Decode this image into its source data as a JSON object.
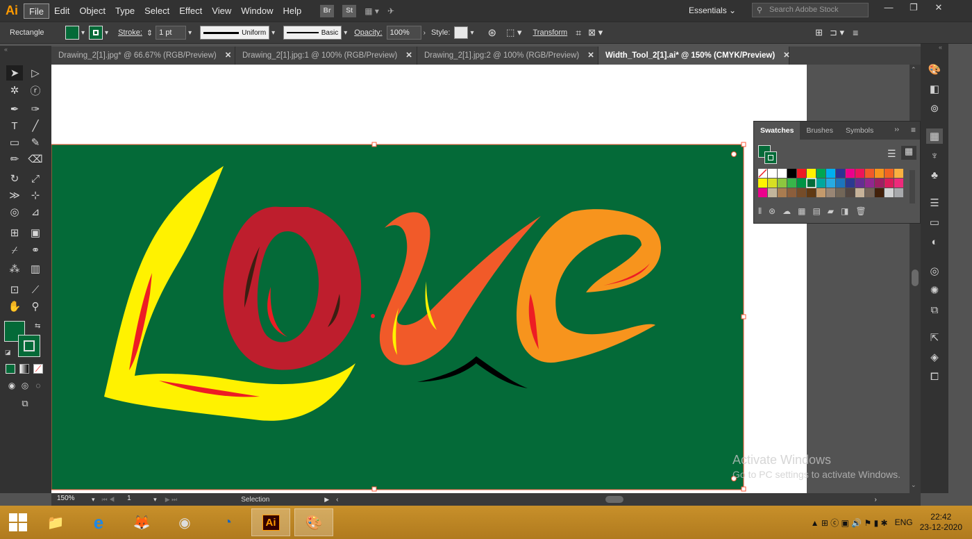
{
  "app": {
    "logo": "Ai"
  },
  "menu": [
    "File",
    "Edit",
    "Object",
    "Type",
    "Select",
    "Effect",
    "View",
    "Window",
    "Help"
  ],
  "top_icons": {
    "bridge": "Br",
    "stock_app": "St"
  },
  "workspace": "Essentials",
  "search_placeholder": "Search Adobe Stock",
  "control": {
    "selection_type": "Rectangle",
    "stroke_label": "Stroke:",
    "stroke_weight": "1 pt",
    "profile_uniform": "Uniform",
    "profile_basic": "Basic",
    "opacity_label": "Opacity:",
    "opacity_value": "100%",
    "style_label": "Style:",
    "transform_label": "Transform",
    "fill_color": "#046a38"
  },
  "tabs": [
    {
      "label": "Drawing_2[1].jpg* @ 66.67% (RGB/Preview)"
    },
    {
      "label": "Drawing_2[1].jpg:1 @ 100% (RGB/Preview)"
    },
    {
      "label": "Drawing_2[1].jpg:2 @ 100% (RGB/Preview)"
    },
    {
      "label": "Width_Tool_2[1].ai* @ 150% (CMYK/Preview)"
    }
  ],
  "panel": {
    "tabs": [
      "Swatches",
      "Brushes",
      "Symbols"
    ]
  },
  "status": {
    "zoom": "150%",
    "page": "1",
    "tool": "Selection"
  },
  "watermark": {
    "line1": "Activate Windows",
    "line2": "Go to PC settings to activate Windows."
  },
  "taskbar": {
    "lang": "ENG",
    "time": "22:42",
    "date": "23-12-2020"
  },
  "colors": {
    "artboard_green": "#046a38",
    "accent_orange": "#ff9a00"
  },
  "icons": [
    "selection-tool-icon",
    "direct-selection-icon",
    "pen-tool-icon",
    "type-tool-icon",
    "rectangle-tool-icon",
    "brush-tool-icon",
    "rotate-tool-icon",
    "width-tool-icon",
    "eyedropper-icon",
    "hand-tool-icon",
    "zoom-tool-icon"
  ]
}
